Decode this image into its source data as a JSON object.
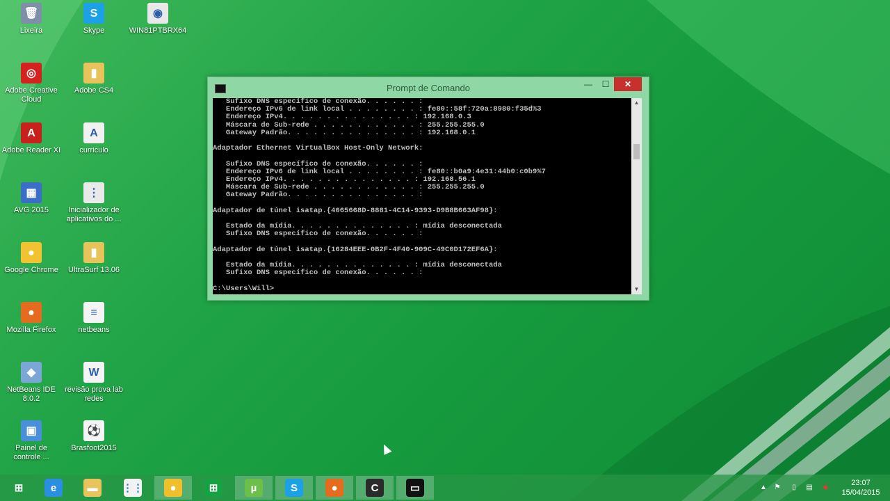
{
  "desktop": {
    "icons": [
      {
        "label": "Lixeira",
        "icon": "recycle-bin-icon",
        "color": "#7f8fa8",
        "glyph": "🗑"
      },
      {
        "label": "Skype",
        "icon": "skype-icon",
        "color": "#1da1e6",
        "glyph": "S"
      },
      {
        "label": "WIN81PTBRX64",
        "icon": "disc-image-icon",
        "color": "#e8e8e8",
        "glyph": "◉"
      },
      {
        "label": "Adobe Creative Cloud",
        "icon": "adobe-cc-icon",
        "color": "#d4231f",
        "glyph": "◎"
      },
      {
        "label": "Adobe CS4",
        "icon": "folder-icon",
        "color": "#e7c35b",
        "glyph": "▮"
      },
      {
        "label": "Adobe Reader XI",
        "icon": "pdf-icon",
        "color": "#c8201a",
        "glyph": "A"
      },
      {
        "label": "curriculo",
        "icon": "pdf-document-icon",
        "color": "#f1f1f1",
        "glyph": "A"
      },
      {
        "label": "AVG 2015",
        "icon": "avg-icon",
        "color": "#3b6fc7",
        "glyph": "▦"
      },
      {
        "label": "Inicializador de aplicativos do ...",
        "icon": "apps-launcher-icon",
        "color": "#e9e9e9",
        "glyph": "⋮"
      },
      {
        "label": "Google Chrome",
        "icon": "chrome-icon",
        "color": "#f2c230",
        "glyph": "●"
      },
      {
        "label": "UltraSurf 13.06",
        "icon": "folder-zip-icon",
        "color": "#e7c35b",
        "glyph": "▮"
      },
      {
        "label": "Mozilla Firefox",
        "icon": "firefox-icon",
        "color": "#e56b1f",
        "glyph": "●"
      },
      {
        "label": "netbeans",
        "icon": "text-file-icon",
        "color": "#f4f4f4",
        "glyph": "≡"
      },
      {
        "label": "NetBeans IDE 8.0.2",
        "icon": "netbeans-icon",
        "color": "#7aa7d6",
        "glyph": "◆"
      },
      {
        "label": "revisão prova lab redes",
        "icon": "word-document-icon",
        "color": "#f4f4f4",
        "glyph": "W"
      },
      {
        "label": "Painel de controle ...",
        "icon": "control-panel-icon",
        "color": "#4a8fd9",
        "glyph": "▣"
      },
      {
        "label": "Brasfoot2015",
        "icon": "brasfoot-icon",
        "color": "#f4f4f4",
        "glyph": "⚽"
      }
    ]
  },
  "cmd": {
    "title": "Prompt de Comando",
    "minimize": "—",
    "maximize": "☐",
    "close": "✕",
    "lines": [
      "   Sufixo DNS específico de conexão. . . . . . :",
      "   Endereço IPv6 de link local . . . . . . . . : fe80::58f:720a:8980:f35d%3",
      "   Endereço IPv4. . . . . . . . . . . . . . . : 192.168.0.3",
      "   Máscara de Sub-rede . . . . . . . . . . . . : 255.255.255.0",
      "   Gateway Padrão. . . . . . . . . . . . . . . : 192.168.0.1",
      "",
      "Adaptador Ethernet VirtualBox Host-Only Network:",
      "",
      "   Sufixo DNS específico de conexão. . . . . . :",
      "   Endereço IPv6 de link local . . . . . . . . : fe80::b0a9:4e31:44b0:c0b9%7",
      "   Endereço IPv4. . . . . . . . . . . . . . . : 192.168.56.1",
      "   Máscara de Sub-rede . . . . . . . . . . . . : 255.255.255.0",
      "   Gateway Padrão. . . . . . . . . . . . . . . :",
      "",
      "Adaptador de túnel isatap.{4065668D-8881-4C14-9393-D9B8B663AF98}:",
      "",
      "   Estado da mídia. . . . . . . . . . . . . . : mídia desconectada",
      "   Sufixo DNS específico de conexão. . . . . . :",
      "",
      "Adaptador de túnel isatap.{16284EEE-0B2F-4F40-909C-49C0D172EF6A}:",
      "",
      "   Estado da mídia. . . . . . . . . . . . . . : mídia desconectada",
      "   Sufixo DNS específico de conexão. . . . . . :",
      "",
      "C:\\Users\\Will>"
    ]
  },
  "taskbar": {
    "buttons": [
      {
        "name": "start-button",
        "icon": "windows-logo-icon",
        "glyph": "⊞",
        "color": "transparent",
        "active": false
      },
      {
        "name": "taskbar-internet-explorer",
        "icon": "internet-explorer-icon",
        "glyph": "e",
        "color": "#2a8fe0",
        "active": false
      },
      {
        "name": "taskbar-file-explorer",
        "icon": "folder-icon",
        "glyph": "▬",
        "color": "#e9c45c",
        "active": false
      },
      {
        "name": "taskbar-apps-launcher",
        "icon": "apps-grid-icon",
        "glyph": "⋮⋮",
        "color": "#f2f2f2",
        "active": false
      },
      {
        "name": "taskbar-chrome",
        "icon": "chrome-icon",
        "glyph": "●",
        "color": "#f0bf2c",
        "active": true
      },
      {
        "name": "taskbar-store",
        "icon": "store-icon",
        "glyph": "⊞",
        "color": "#16a145",
        "active": false
      },
      {
        "name": "taskbar-utorrent",
        "icon": "utorrent-icon",
        "glyph": "µ",
        "color": "#6cc04a",
        "active": true
      },
      {
        "name": "taskbar-skype",
        "icon": "skype-icon",
        "glyph": "S",
        "color": "#1da1e6",
        "active": true
      },
      {
        "name": "taskbar-firefox",
        "icon": "firefox-icon",
        "glyph": "●",
        "color": "#e56b1f",
        "active": true
      },
      {
        "name": "taskbar-camtasia",
        "icon": "camtasia-icon",
        "glyph": "C",
        "color": "#2b2b2b",
        "active": true
      },
      {
        "name": "taskbar-command-prompt",
        "icon": "command-prompt-icon",
        "glyph": "▭",
        "color": "#111111",
        "active": true
      }
    ],
    "tray": {
      "clock_time": "23:07",
      "clock_date": "15/04/2015"
    }
  }
}
